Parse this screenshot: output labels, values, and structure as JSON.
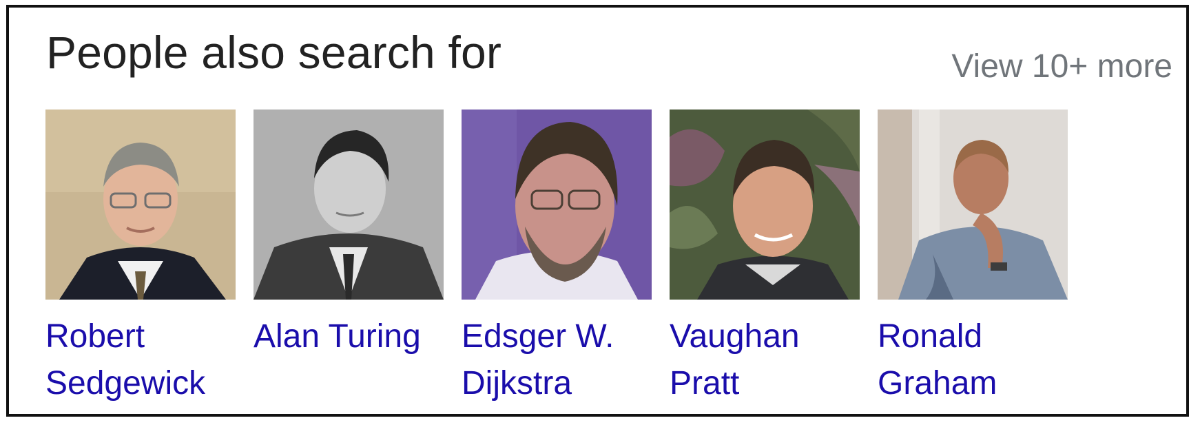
{
  "panel": {
    "title": "People also search for",
    "view_more_label": "View 10+ more"
  },
  "people": [
    {
      "name_line1": "Robert",
      "name_line2": "Sedgewick",
      "photo_icon": "portrait-robert-sedgewick"
    },
    {
      "name_line1": "Alan Turing",
      "name_line2": "",
      "photo_icon": "portrait-alan-turing"
    },
    {
      "name_line1": "Edsger W.",
      "name_line2": "Dijkstra",
      "photo_icon": "portrait-edsger-dijkstra"
    },
    {
      "name_line1": "Vaughan",
      "name_line2": "Pratt",
      "photo_icon": "portrait-vaughan-pratt"
    },
    {
      "name_line1": "Ronald",
      "name_line2": "Graham",
      "photo_icon": "portrait-ronald-graham"
    }
  ],
  "colors": {
    "link": "#1a0dab",
    "muted": "#70757a",
    "title": "#222222",
    "border": "#111111"
  }
}
